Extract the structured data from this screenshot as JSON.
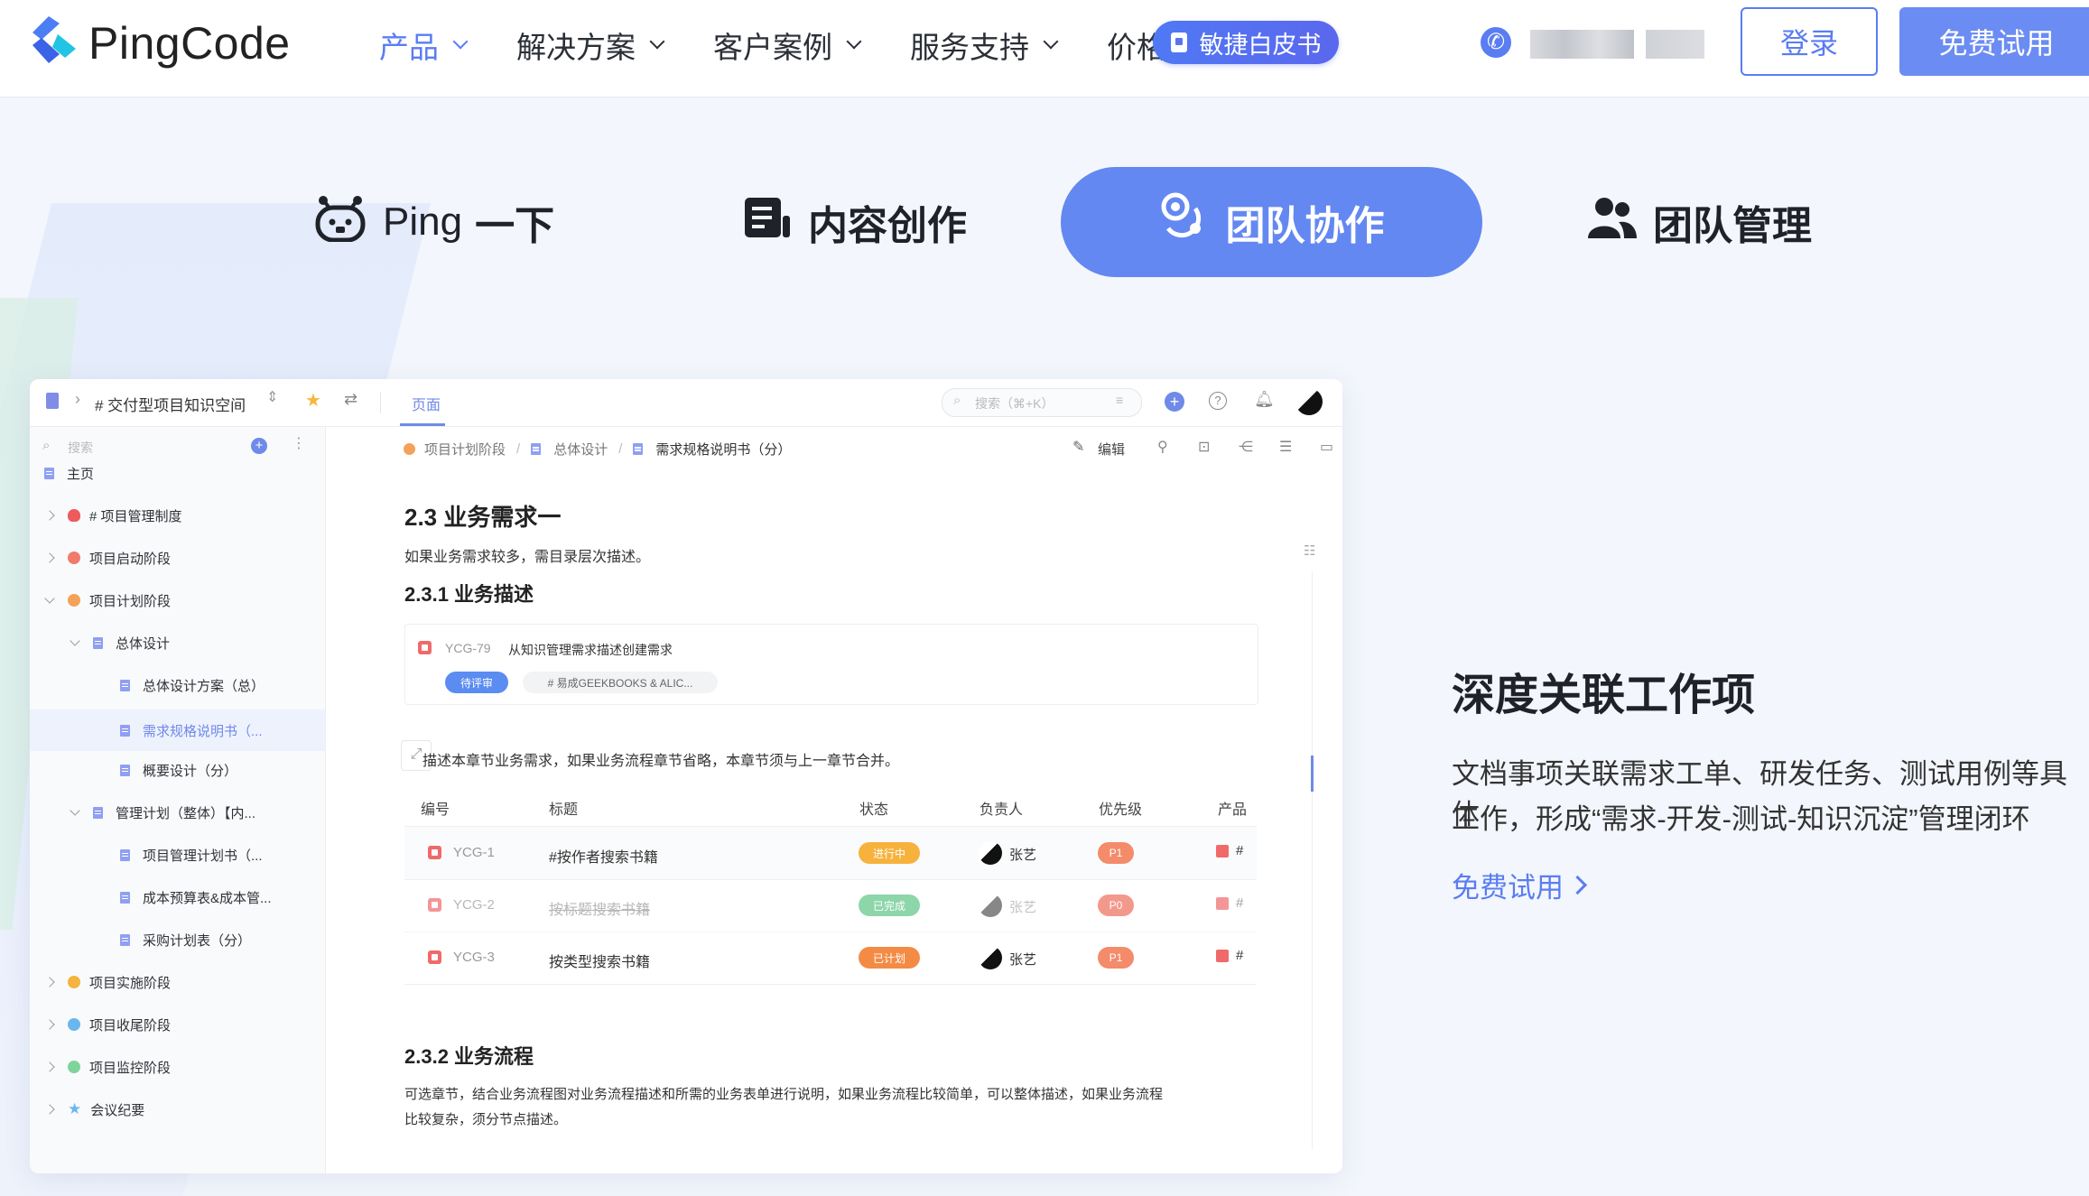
{
  "brand": {
    "name": "PingCode",
    "accent": "#5a7df2"
  },
  "nav": {
    "items": [
      {
        "label": "产品",
        "active": true,
        "has_dropdown": true
      },
      {
        "label": "解决方案",
        "has_dropdown": true
      },
      {
        "label": "客户案例",
        "has_dropdown": true
      },
      {
        "label": "服务支持",
        "has_dropdown": true
      },
      {
        "label": "价格",
        "has_dropdown": false
      }
    ],
    "whitepaper": "敏捷白皮书",
    "login": "登录",
    "trial": "免费试用"
  },
  "feature_tabs": [
    {
      "label_a": "Ping",
      "label_b": "一下",
      "icon": "robot-icon"
    },
    {
      "label": "内容创作",
      "icon": "document-icon"
    },
    {
      "label": "团队协作",
      "icon": "collaboration-icon",
      "active": true
    },
    {
      "label": "团队管理",
      "icon": "users-icon"
    }
  ],
  "app": {
    "space_title": "# 交付型项目知识空间",
    "header_tab": "页面",
    "search_placeholder": "搜索（⌘+K）",
    "sidebar": {
      "search_placeholder": "搜索",
      "items": [
        {
          "label": "主页"
        },
        {
          "label": "# 项目管理制度"
        },
        {
          "label": "项目启动阶段"
        },
        {
          "label": "项目计划阶段"
        },
        {
          "label": "总体设计"
        },
        {
          "label": "总体设计方案（总）"
        },
        {
          "label": "需求规格说明书（..."
        },
        {
          "label": "概要设计（分）"
        },
        {
          "label": "管理计划（整体）【内..."
        },
        {
          "label": "项目管理计划书（..."
        },
        {
          "label": "成本预算表&成本管..."
        },
        {
          "label": "采购计划表（分）"
        },
        {
          "label": "项目实施阶段"
        },
        {
          "label": "项目收尾阶段"
        },
        {
          "label": "项目监控阶段"
        },
        {
          "label": "会议纪要"
        }
      ]
    },
    "breadcrumb": [
      "项目计划阶段",
      "总体设计",
      "需求规格说明书（分）"
    ],
    "edit_label": "编辑",
    "doc": {
      "h1": "2.3  业务需求一",
      "p1": "如果业务需求较多，需目录层次描述。",
      "h2": "2.3.1    业务描述",
      "card": {
        "id": "YCG-79",
        "title": "从知识管理需求描述创建需求",
        "status": "待评审",
        "tag": "# 易成GEEKBOOKS & ALIC..."
      },
      "p2": "描述本章节业务需求，如果业务流程章节省略，本章节须与上一章节合并。",
      "table": {
        "headers": [
          "编号",
          "标题",
          "状态",
          "负责人",
          "优先级",
          "产品"
        ],
        "rows": [
          {
            "id": "YCG-1",
            "title": "#按作者搜索书籍",
            "status": "进行中",
            "status_color": "#f6b23d",
            "owner": "张艺",
            "priority": "P1",
            "product": "#"
          },
          {
            "id": "YCG-2",
            "title": "按标题搜索书籍",
            "status": "已完成",
            "status_color": "#5ec585",
            "owner": "张艺",
            "priority": "P0",
            "product": "#"
          },
          {
            "id": "YCG-3",
            "title": "按类型搜索书籍",
            "status": "已计划",
            "status_color": "#f48b44",
            "owner": "张艺",
            "priority": "P1",
            "product": "#"
          }
        ]
      },
      "h3": "2.3.2    业务流程",
      "p3a": "可选章节，结合业务流程图对业务流程描述和所需的业务表单进行说明，如果业务流程比较简单，可以整体描述，如果业务流程",
      "p3b": "比较复杂，须分节点描述。"
    }
  },
  "side": {
    "title": "深度关联工作项",
    "desc_1": "文档事项关联需求工单、研发任务、测试用例等具体",
    "desc_2": "工作，形成“需求-开发-测试-知识沉淀”管理闭环",
    "link": "免费试用"
  }
}
